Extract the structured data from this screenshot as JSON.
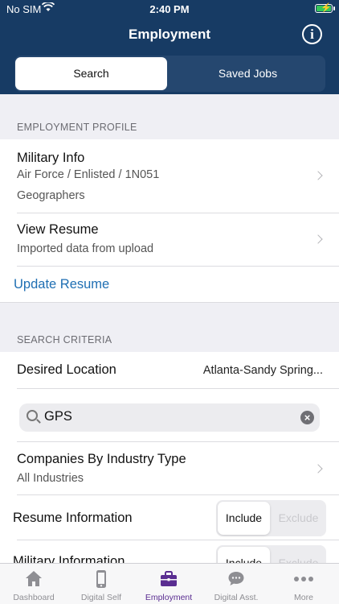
{
  "status_bar": {
    "carrier": "No SIM",
    "time": "2:40 PM"
  },
  "nav": {
    "title": "Employment",
    "info_icon": "info-icon"
  },
  "segments": {
    "active": "Search",
    "inactive": "Saved Jobs"
  },
  "profile": {
    "section_title": "EMPLOYMENT PROFILE",
    "military": {
      "title": "Military Info",
      "line1": "Air Force / Enlisted / 1N051",
      "line2": "Geographers"
    },
    "resume": {
      "title": "View Resume",
      "subtitle": "Imported data from upload"
    },
    "update_link": "Update Resume"
  },
  "criteria": {
    "section_title": "SEARCH CRITERIA",
    "location": {
      "label": "Desired Location",
      "value": "Atlanta-Sandy Spring..."
    },
    "search": {
      "value": "GPS"
    },
    "industry": {
      "title": "Companies By Industry Type",
      "subtitle": "All Industries"
    },
    "resume_info": {
      "label": "Resume Information",
      "include": "Include",
      "exclude": "Exclude"
    },
    "military_info": {
      "label": "Military Information",
      "include": "Include",
      "exclude": "Exclude"
    }
  },
  "tabs": [
    {
      "label": "Dashboard",
      "icon": "home-icon"
    },
    {
      "label": "Digital Self",
      "icon": "phone-icon"
    },
    {
      "label": "Employment",
      "icon": "briefcase-icon"
    },
    {
      "label": "Digital Asst.",
      "icon": "chat-bubble-icon"
    },
    {
      "label": "More",
      "icon": "more-dots-icon"
    }
  ],
  "colors": {
    "header": "#173b64",
    "accent_tab": "#5a2d91",
    "link": "#1f6fb3",
    "battery": "#35c759"
  }
}
